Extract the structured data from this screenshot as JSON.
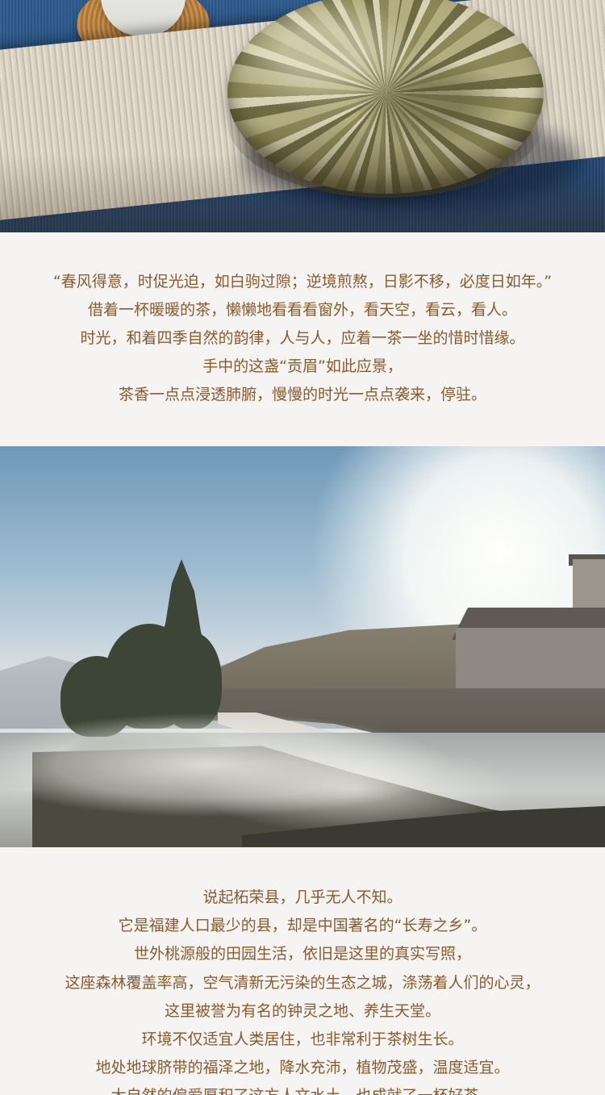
{
  "photos": {
    "tea_cake": {
      "icon": "tea-cake-photo"
    },
    "landscape": {
      "icon": "misty-village-landscape-photo"
    }
  },
  "block1": {
    "lines": [
      "“春风得意，时促光迫，如白驹过隙；逆境煎熬，日影不移，必度日如年。”",
      "借着一杯暖暖的茶，懒懒地看看看窗外，看天空，看云，看人。",
      "时光，和着四季自然的韵律，人与人，应着一茶一坐的惜时惜缘。",
      "手中的这盏“贡眉”如此应景，",
      "茶香一点点浸透肺腑，慢慢的时光一点点袭来，停驻。"
    ]
  },
  "block2": {
    "lines": [
      "说起柘荣县，几乎无人不知。",
      "它是福建人口最少的县，却是中国著名的“长寿之乡”。",
      "世外桃源般的田园生活，依旧是这里的真实写照，",
      "这座森林覆盖率高，空气清新无污染的生态之城，涤荡着人们的心灵，",
      "这里被誉为有名的钟灵之地、养生天堂。",
      "环境不仅适宜人类居住，也非常利于茶树生长。",
      "地处地球脐带的福泽之地，降水充沛，植物茂盛，温度适宜。",
      "大自然的偏爱厚积了这方人文水土，也成就了一杯好茶。"
    ]
  },
  "colors": {
    "text": "#8a5a2e",
    "background": "#f5f4f2"
  }
}
